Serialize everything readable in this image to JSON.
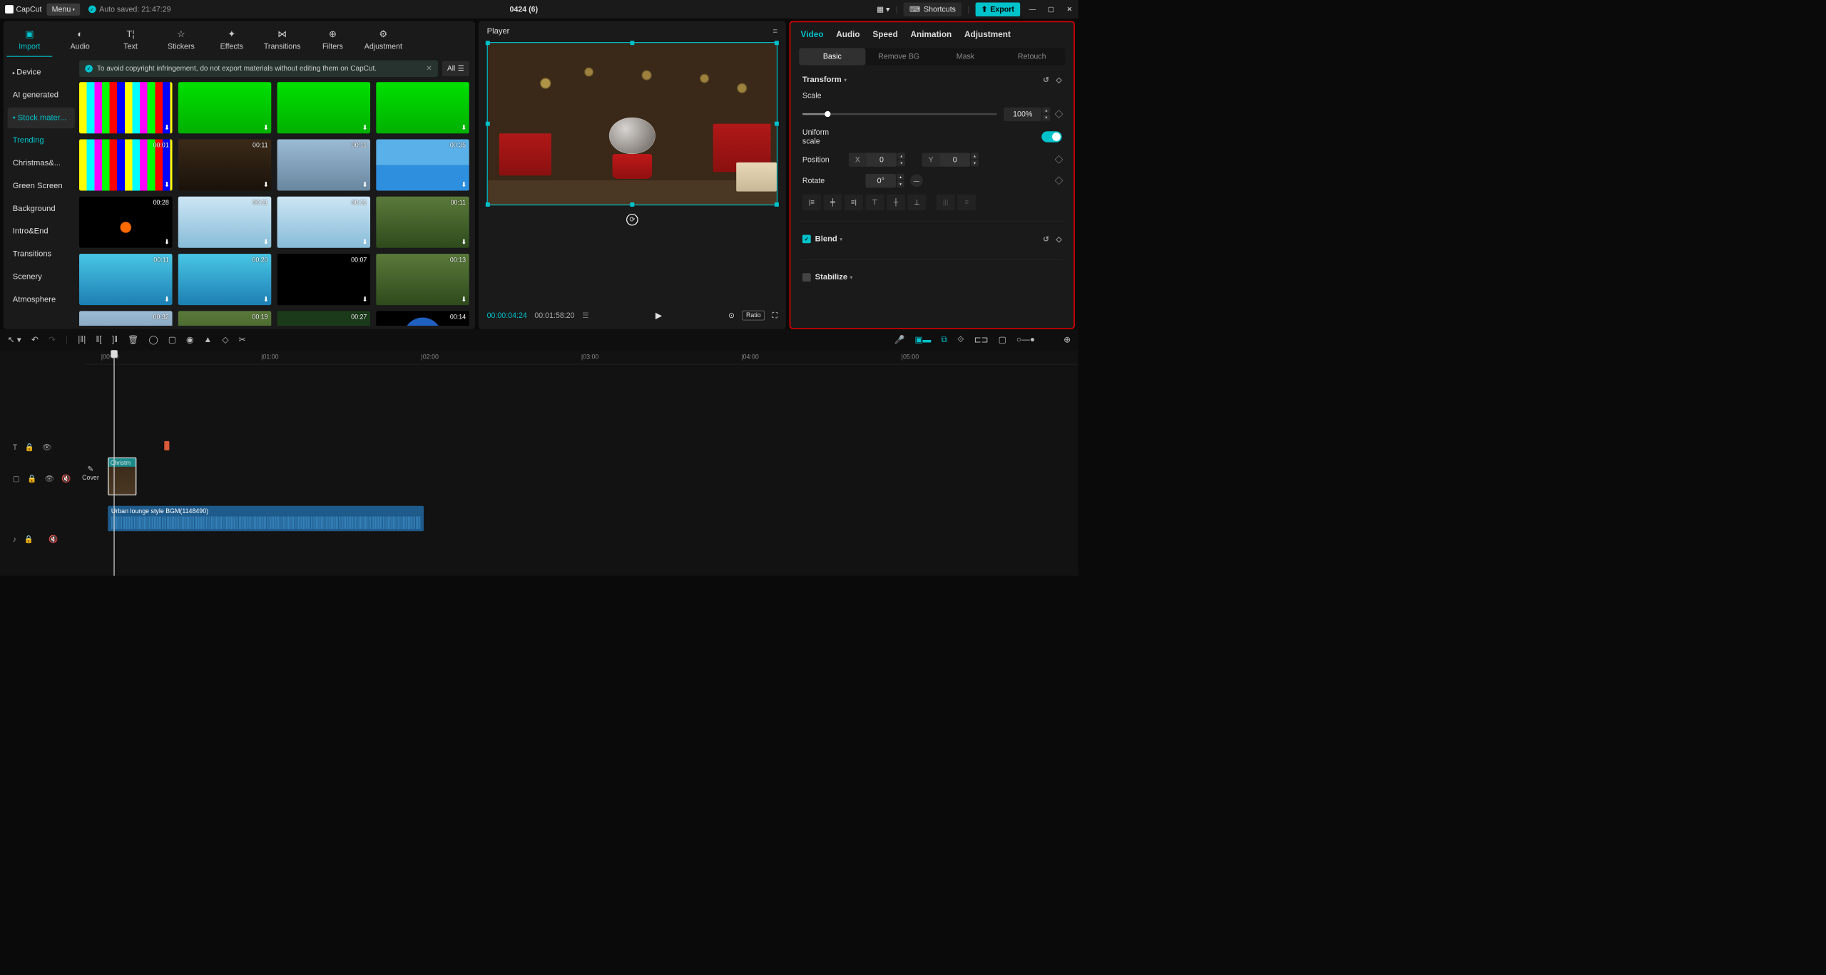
{
  "titlebar": {
    "app": "CapCut",
    "menu": "Menu",
    "autosave": "Auto saved: 21:47:29",
    "project": "0424 (6)",
    "shortcuts": "Shortcuts",
    "export": "Export"
  },
  "tool_tabs": [
    "Import",
    "Audio",
    "Text",
    "Stickers",
    "Effects",
    "Transitions",
    "Filters",
    "Adjustment"
  ],
  "tool_icons": [
    "▣",
    "◐",
    "T¦",
    "☆",
    "✦",
    "⋈",
    "⊕",
    "⚙"
  ],
  "categories": [
    "Device",
    "AI generated",
    "Stock mater...",
    "Trending",
    "Christmas&...",
    "Green Screen",
    "Background",
    "Intro&End",
    "Transitions",
    "Scenery",
    "Atmosphere"
  ],
  "cat_selected": 2,
  "cat_highlight": 3,
  "warn": "To avoid copyright infringement, do not export materials without editing them on CapCut.",
  "filter_all": "All",
  "thumbs": [
    {
      "d": "",
      "c": "testcard"
    },
    {
      "d": "",
      "c": "green"
    },
    {
      "d": "",
      "c": "green"
    },
    {
      "d": "",
      "c": "green"
    },
    {
      "d": "00:01",
      "c": "testcard"
    },
    {
      "d": "00:11",
      "c": "xmas"
    },
    {
      "d": "00:11",
      "c": "city"
    },
    {
      "d": "00:35",
      "c": "beach"
    },
    {
      "d": "00:28",
      "c": "fireworks"
    },
    {
      "d": "00:11",
      "c": "people"
    },
    {
      "d": "00:11",
      "c": "people"
    },
    {
      "d": "00:11",
      "c": "nature"
    },
    {
      "d": "00:11",
      "c": "ocean"
    },
    {
      "d": "00:20",
      "c": "ocean"
    },
    {
      "d": "00:07",
      "c": "dark"
    },
    {
      "d": "00:13",
      "c": "nature"
    },
    {
      "d": "00:32",
      "c": "city"
    },
    {
      "d": "00:19",
      "c": "nature"
    },
    {
      "d": "00:27",
      "c": "flowers"
    },
    {
      "d": "00:14",
      "c": "earth"
    }
  ],
  "player": {
    "title": "Player",
    "tc_current": "00:00:04:24",
    "tc_duration": "00:01:58:20",
    "ratio": "Ratio"
  },
  "inspector": {
    "tabs": [
      "Video",
      "Audio",
      "Speed",
      "Animation",
      "Adjustment"
    ],
    "sub_tabs": [
      "Basic",
      "Remove BG",
      "Mask",
      "Retouch"
    ],
    "transform": "Transform",
    "scale": "Scale",
    "scale_val": "100%",
    "uniform": "Uniform scale",
    "position": "Position",
    "pos_x_lbl": "X",
    "pos_x": "0",
    "pos_y_lbl": "Y",
    "pos_y": "0",
    "rotate": "Rotate",
    "rotate_val": "0°",
    "blend": "Blend",
    "stabilize": "Stabilize"
  },
  "ruler": [
    "|00:00",
    "|01:00",
    "|02:00",
    "|03:00",
    "|04:00",
    "|05:00"
  ],
  "ruler_pos": [
    40,
    420,
    800,
    1180,
    1560,
    1940
  ],
  "cover": "Cover",
  "clip_video_label": "Christm",
  "clip_audio_label": "Urban lounge style BGM(1148490)"
}
